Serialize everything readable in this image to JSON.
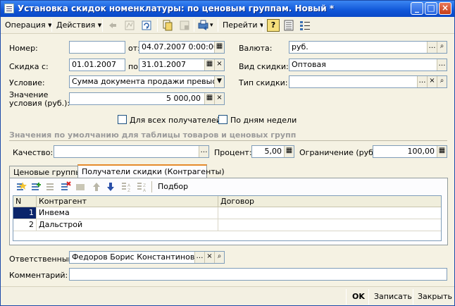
{
  "window": {
    "title": "Установка скидок номенклатуры: по ценовым группам. Новый *",
    "minimize": "_",
    "maximize": "□",
    "close": "×"
  },
  "toolbar": {
    "operation_label": "Операция",
    "actions_label": "Действия",
    "goto_label": "Перейти",
    "help_label": "?"
  },
  "form": {
    "number_label": "Номер:",
    "number_value": "",
    "from_label": "от:",
    "from_value": "04.07.2007  0:00:00",
    "discount_from_label": "Скидка с:",
    "discount_from_value": "01.01.2007",
    "to_label": "по:",
    "to_value": "31.01.2007",
    "condition_label": "Условие:",
    "condition_value": "Сумма документа продажи превысила",
    "cond_value_label_1": "Значение",
    "cond_value_label_2": "условия (руб.):",
    "cond_value": "5 000,00",
    "currency_label": "Валюта:",
    "currency_value": "руб.",
    "discount_kind_label": "Вид скидки:",
    "discount_kind_value": "Оптовая",
    "discount_type_label": "Тип скидки:",
    "discount_type_value": "",
    "all_recipients_label": "Для всех получателей",
    "by_weekdays_label": "По дням недели"
  },
  "defaults": {
    "section_title": "Значения по умолчанию для таблицы товаров и ценовых групп",
    "quality_label": "Качество:",
    "quality_value": "",
    "percent_label": "Процент:",
    "percent_value": "5,00",
    "limit_label": "Ограничение (руб.):",
    "limit_value": "100,00"
  },
  "tabs": [
    {
      "label": "Ценовые группы"
    },
    {
      "label": "Получатели скидки (Контрагенты)"
    }
  ],
  "table_toolbar": {
    "select_label": "Подбор"
  },
  "table": {
    "columns": [
      "N",
      "Контрагент",
      "Договор"
    ],
    "rows": [
      {
        "n": "1",
        "counterparty": "Инвема",
        "contract": ""
      },
      {
        "n": "2",
        "counterparty": "Дальстрой",
        "contract": ""
      }
    ]
  },
  "footer": {
    "responsible_label": "Ответственный:",
    "responsible_value": "Федоров Борис Константинович",
    "comment_label": "Комментарий:",
    "comment_value": ""
  },
  "statusbar": {
    "ok_label": "OK",
    "save_label": "Записать",
    "close_label": "Закрыть"
  },
  "colors": {
    "titlebar": "#0a48c6",
    "window_bg": "#f5f2e3",
    "selection": "#0a246a",
    "tab_accent": "#e68b2c"
  }
}
